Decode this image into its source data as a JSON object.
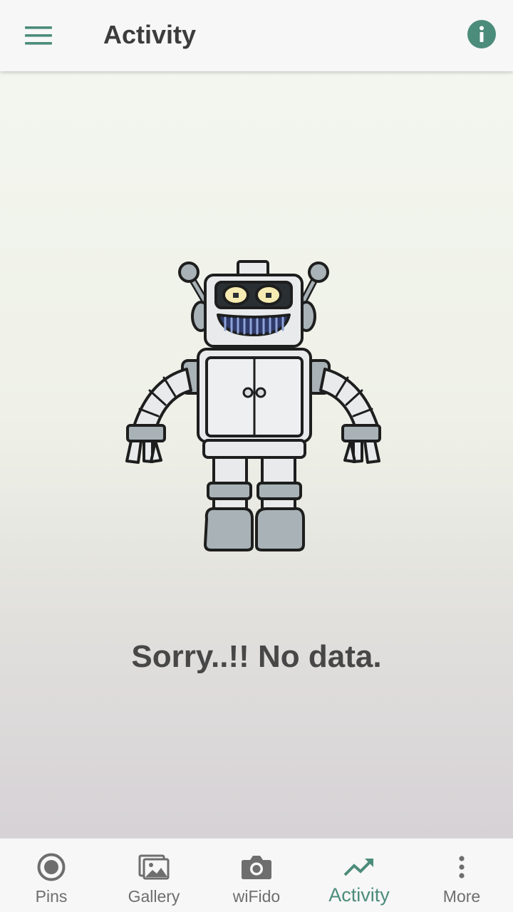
{
  "header": {
    "title": "Activity",
    "menu_icon": "hamburger-menu-icon",
    "info_icon": "info-icon",
    "accent_color": "#4c8c7a"
  },
  "main": {
    "illustration": "robot-illustration",
    "empty_message": "Sorry..!! No data."
  },
  "bottom_nav": {
    "active_index": 3,
    "items": [
      {
        "label": "Pins",
        "icon": "radio-button-icon"
      },
      {
        "label": "Gallery",
        "icon": "gallery-icon"
      },
      {
        "label": "wiFido",
        "icon": "camera-icon"
      },
      {
        "label": "Activity",
        "icon": "trending-up-icon"
      },
      {
        "label": "More",
        "icon": "more-vertical-icon"
      }
    ]
  }
}
